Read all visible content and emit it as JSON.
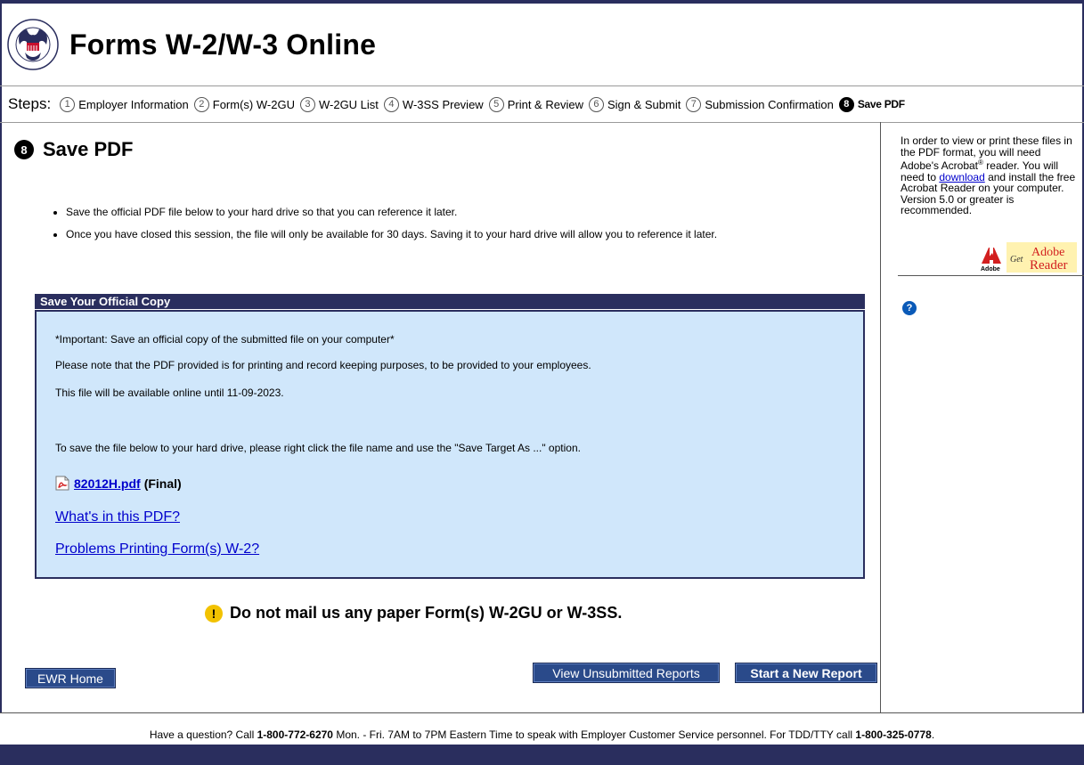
{
  "header": {
    "title": "Forms W-2/W-3 Online"
  },
  "steps": {
    "label": "Steps:",
    "items": [
      {
        "num": "1",
        "label": "Employer Information"
      },
      {
        "num": "2",
        "label": "Form(s) W-2GU"
      },
      {
        "num": "3",
        "label": "W-2GU List"
      },
      {
        "num": "4",
        "label": "W-3SS Preview"
      },
      {
        "num": "5",
        "label": "Print & Review"
      },
      {
        "num": "6",
        "label": "Sign & Submit"
      },
      {
        "num": "7",
        "label": "Submission Confirmation"
      },
      {
        "num": "8",
        "label": "Save PDF"
      }
    ]
  },
  "page": {
    "step_num": "8",
    "title": "Save PDF",
    "bullets": [
      "Save the official PDF file below to your hard drive so that you can reference it later.",
      "Once you have closed this session, the file will only be available for 30 days. Saving it to your hard drive will allow you to reference it later."
    ]
  },
  "panel": {
    "header": "Save Your Official Copy",
    "important": "*Important: Save an official copy of the submitted file on your computer*",
    "note": "Please note that the PDF provided is for printing and record keeping purposes, to be provided to your employees.",
    "availability": "This file will be available online until 11-09-2023.",
    "save_instructions": "To save the file below to your hard drive, please right click the file name and use the \"Save Target As ...\" option.",
    "file_name": "82012H.pdf",
    "file_status": "(Final)",
    "whats_in_link": "What's in this PDF?",
    "problems_link": "Problems Printing Form(s) W-2?"
  },
  "warning": {
    "text": "Do not mail us any paper Form(s) W-2GU or W-3SS."
  },
  "buttons": {
    "home": "EWR Home",
    "unsubmitted": "View Unsubmitted Reports",
    "new_report": "Start a New Report"
  },
  "sidebar": {
    "text_before_reg": "In order to view or print these files in the PDF format, you will need Adobe's Acrobat",
    "reg_mark": "®",
    "text_after_reg": " reader. You will need to ",
    "download_link": "download",
    "text_after_link": " and install the free Acrobat Reader on your computer. Version 5.0 or greater is recommended.",
    "badge_get": "Get",
    "badge_adobe": "Adobe",
    "badge_reader": "Reader",
    "badge_small": "Adobe",
    "help_glyph": "?"
  },
  "footer": {
    "prefix": "Have a question? Call ",
    "phone": "1-800-772-6270",
    "middle": " Mon. - Fri. 7AM to 7PM Eastern Time to speak with Employer Customer Service personnel. For TDD/TTY call ",
    "tty": "1-800-325-0778",
    "suffix": "."
  },
  "colors": {
    "navy": "#2a2e5e",
    "panel_bg": "#d0e7fb",
    "button": "#2a4a8a",
    "link": "#0000cc",
    "warning": "#f2c200"
  }
}
